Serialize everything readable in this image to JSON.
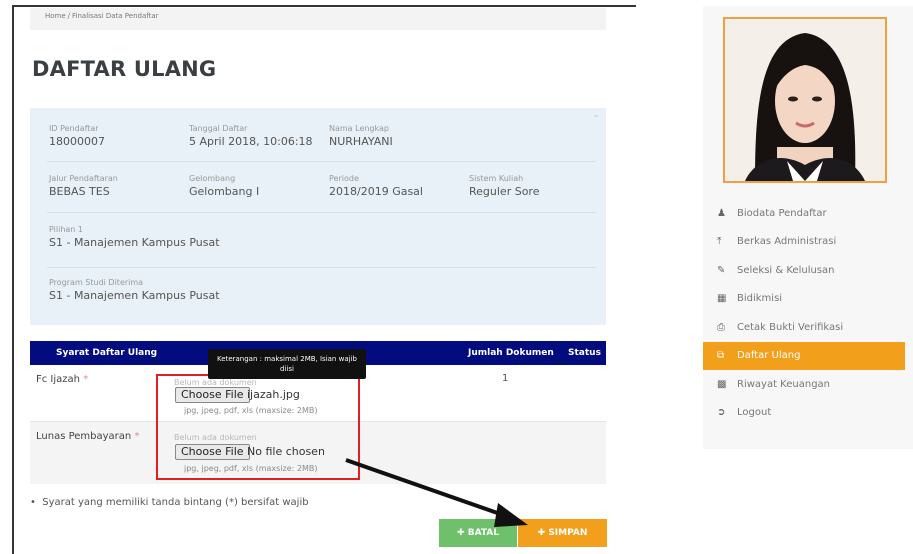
{
  "breadcrumb": {
    "home": "Home",
    "current": "Finalisasi Data Pendaftar"
  },
  "page_title": "DAFTAR ULANG",
  "info": {
    "id_pendaftar": {
      "label": "ID Pendaftar",
      "value": "18000007"
    },
    "tanggal_daftar": {
      "label": "Tanggal Daftar",
      "value": "5 April 2018, 10:06:18"
    },
    "nama_lengkap": {
      "label": "Nama Lengkap",
      "value": "NURHAYANI"
    },
    "jalur_pendaftaran": {
      "label": "Jalur Pendaftaran",
      "value": "BEBAS TES"
    },
    "gelombang": {
      "label": "Gelombang",
      "value": "Gelombang I"
    },
    "periode": {
      "label": "Periode",
      "value": "2018/2019 Gasal"
    },
    "sistem_kuliah": {
      "label": "Sistem Kuliah",
      "value": "Reguler Sore"
    },
    "pilihan_1": {
      "label": "Pilihan 1",
      "value": "S1 - Manajemen Kampus Pusat"
    },
    "prodi_diterima": {
      "label": "Program Studi Diterima",
      "value": "S1 - Manajemen Kampus Pusat"
    }
  },
  "table": {
    "columns": [
      "Syarat Daftar Ulang",
      "Jumlah Dokumen",
      "Status"
    ],
    "rows": [
      {
        "label": "Fc Ijazah",
        "placeholder": "Belum ada dokumen",
        "button": "Choose File",
        "file": "ijazah.jpg",
        "hint": "jpg, jpeg, pdf, xls (maxsize: 2MB)",
        "count": "1"
      },
      {
        "label": "Lunas Pembayaran",
        "placeholder": "Belum ada dokumen",
        "button": "Choose File",
        "file": "No file chosen",
        "hint": "jpg, jpeg, pdf, xls (maxsize: 2MB)",
        "count": ""
      }
    ]
  },
  "tooltip": "Keterangan : maksimal 2MB, Isian wajib diisi",
  "note": "Syarat yang memiliki tanda bintang (*) bersifat wajib",
  "buttons": {
    "batal": "BATAL",
    "simpan": "SIMPAN"
  },
  "sidebar": {
    "items": [
      {
        "label": "Biodata Pendaftar",
        "icon": "user-icon",
        "active": false
      },
      {
        "label": "Berkas Administrasi",
        "icon": "upload-icon",
        "active": false
      },
      {
        "label": "Seleksi & Kelulusan",
        "icon": "edit-icon",
        "active": false
      },
      {
        "label": "Bidikmisi",
        "icon": "bank-icon",
        "active": false
      },
      {
        "label": "Cetak Bukti Verifikasi",
        "icon": "print-icon",
        "active": false
      },
      {
        "label": "Daftar Ulang",
        "icon": "copy-icon",
        "active": true
      },
      {
        "label": "Riwayat Keuangan",
        "icon": "money-icon",
        "active": false
      },
      {
        "label": "Logout",
        "icon": "logout-icon",
        "active": false
      }
    ]
  },
  "colors": {
    "accent": "#f29f1c",
    "table_header": "#020c7f",
    "success": "#6fc06b",
    "highlight": "#e02020"
  }
}
